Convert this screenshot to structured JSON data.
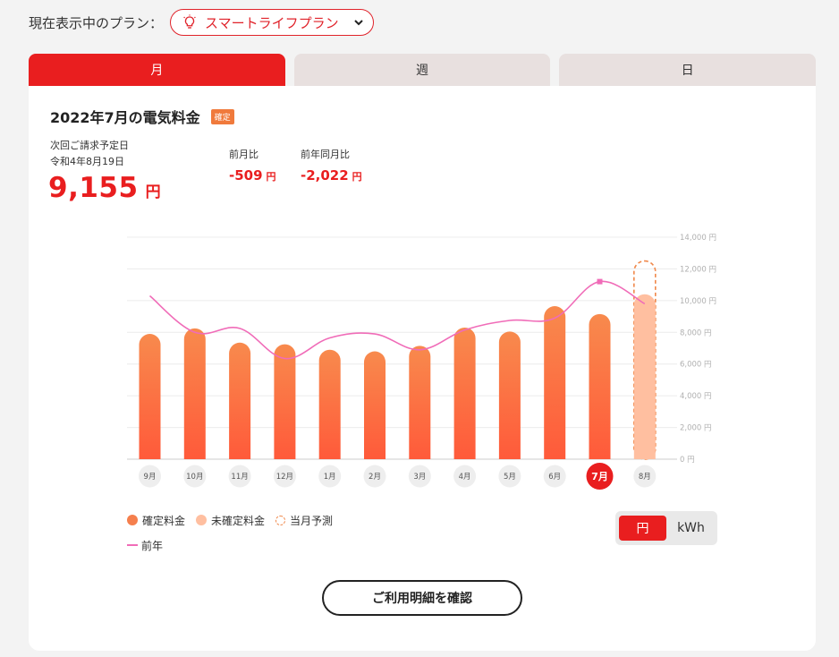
{
  "plan": {
    "label": "現在表示中のプラン：",
    "selected": "スマートライフプラン",
    "icon": "lightbulb-icon"
  },
  "tabs": [
    {
      "label": "月",
      "active": true
    },
    {
      "label": "週",
      "active": false
    },
    {
      "label": "日",
      "active": false
    }
  ],
  "summary": {
    "title": "2022年7月の電気料金",
    "status_badge": "確定",
    "due_label": "次回ご請求予定日",
    "due_date": "令和4年8月19日",
    "amount": "9,155",
    "amount_unit": "円",
    "prev_month_label": "前月比",
    "prev_month_value": "-509",
    "prev_year_label": "前年同月比",
    "prev_year_value": "-2,022",
    "diff_unit": "円"
  },
  "chart_data": {
    "type": "bar",
    "categories": [
      "9月",
      "10月",
      "11月",
      "12月",
      "1月",
      "2月",
      "3月",
      "4月",
      "5月",
      "6月",
      "7月",
      "8月"
    ],
    "selected_category": "7月",
    "series": [
      {
        "name": "確定料金",
        "type": "bar",
        "color": "#f57f4d",
        "values": [
          7900,
          8250,
          7350,
          7250,
          6900,
          6800,
          7150,
          8300,
          8050,
          9650,
          9155,
          null
        ]
      },
      {
        "name": "未確定料金",
        "type": "bar",
        "color": "#ffbfa0",
        "values": [
          null,
          null,
          null,
          null,
          null,
          null,
          null,
          null,
          null,
          null,
          null,
          10400
        ]
      },
      {
        "name": "当月予測",
        "type": "bar-outline",
        "color": "#f0884a",
        "values": [
          null,
          null,
          null,
          null,
          null,
          null,
          null,
          null,
          null,
          null,
          null,
          12500
        ]
      },
      {
        "name": "前年",
        "type": "line",
        "color": "#f06cb8",
        "values": [
          10300,
          8000,
          8250,
          6350,
          7650,
          7900,
          6900,
          8150,
          8750,
          8900,
          11200,
          9800
        ]
      }
    ],
    "y_ticks": [
      "0 円",
      "2,000 円",
      "4,000 円",
      "6,000 円",
      "8,000 円",
      "10,000 円",
      "12,000 円",
      "14,000 円"
    ],
    "ylim": [
      0,
      14000
    ],
    "grid": true
  },
  "legend": {
    "confirmed": "確定料金",
    "unconfirmed": "未確定料金",
    "forecast": "当月予測",
    "prev_year": "前年"
  },
  "unit_toggle": {
    "yen": "円",
    "kwh": "kWh",
    "selected": "円"
  },
  "detail_button": "ご利用明細を確認",
  "colors": {
    "accent": "#e91e1f",
    "confirmed_bar": "#f57f4d",
    "unconfirmed_bar": "#ffbfa0",
    "prev_year_line": "#f06cb8"
  }
}
